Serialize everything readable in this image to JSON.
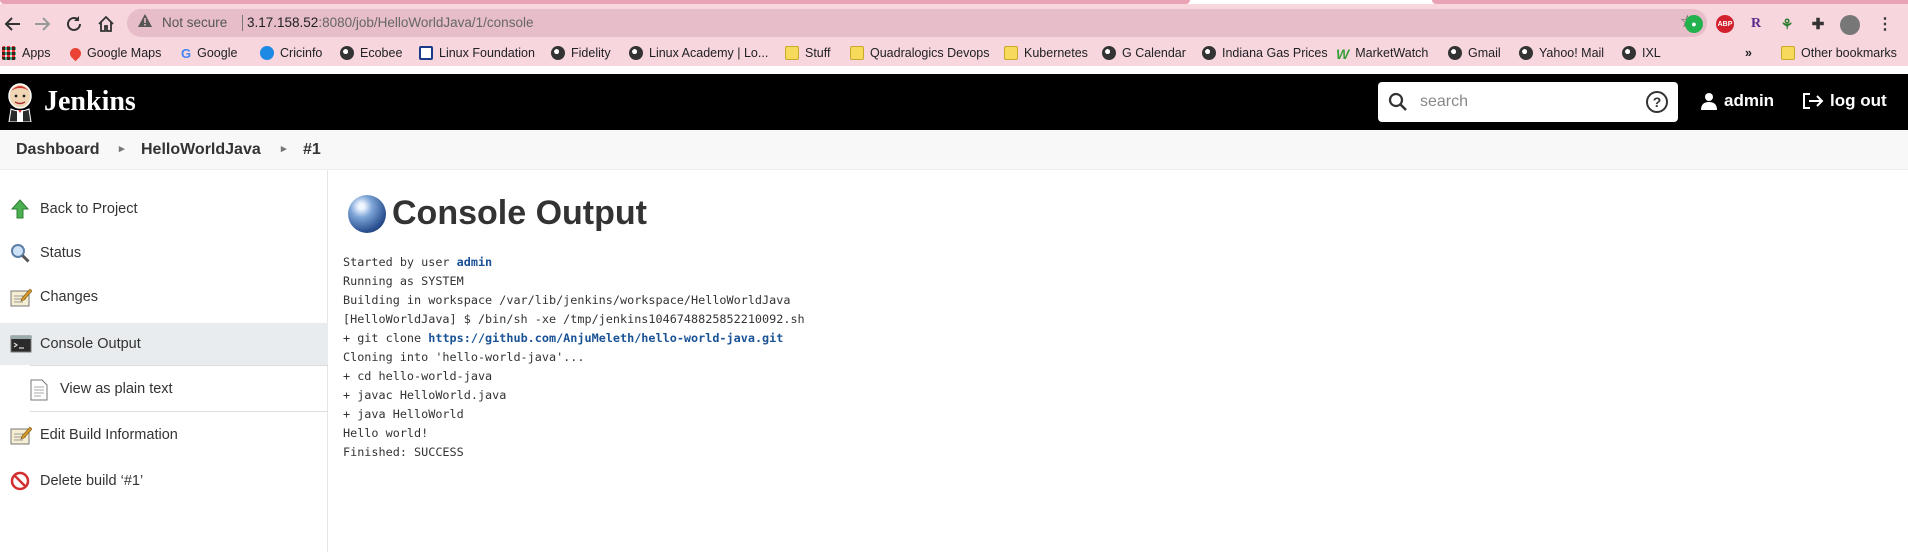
{
  "browser": {
    "security_label": "Not secure",
    "url_host": "3.17.158.52",
    "url_rest": ":8080/job/HelloWorldJava/1/console",
    "bookmarks": [
      {
        "label": "Apps",
        "icon": "apps-grid-icon"
      },
      {
        "label": "Google Maps",
        "icon": "maps-pin-icon"
      },
      {
        "label": "Google",
        "icon": "google-g-icon"
      },
      {
        "label": "Cricinfo",
        "icon": "globe-icon"
      },
      {
        "label": "Ecobee",
        "icon": "globe-icon"
      },
      {
        "label": "Linux Foundation",
        "icon": "square-icon"
      },
      {
        "label": "Fidelity",
        "icon": "globe-icon"
      },
      {
        "label": "Linux Academy | Lo...",
        "icon": "globe-icon"
      },
      {
        "label": "Stuff",
        "icon": "folder-icon"
      },
      {
        "label": "Quadralogics Devops",
        "icon": "folder-icon"
      },
      {
        "label": "Kubernetes",
        "icon": "folder-icon"
      },
      {
        "label": "G Calendar",
        "icon": "globe-icon"
      },
      {
        "label": "Indiana Gas Prices",
        "icon": "globe-icon"
      },
      {
        "label": "MarketWatch",
        "icon": "marketwatch-w-icon"
      },
      {
        "label": "Gmail",
        "icon": "globe-icon"
      },
      {
        "label": "Yahoo! Mail",
        "icon": "globe-icon"
      },
      {
        "label": "IXL",
        "icon": "globe-icon"
      }
    ],
    "more_bookmarks": "»",
    "other_bookmarks": "Other bookmarks",
    "ext_abp": "ABP",
    "ext_r": "R"
  },
  "header": {
    "title": "Jenkins",
    "search_placeholder": "search",
    "help": "?",
    "user": "admin",
    "logout": "log out"
  },
  "breadcrumb": [
    "Dashboard",
    "HelloWorldJava",
    "#1"
  ],
  "sidebar": {
    "items": [
      {
        "label": "Back to Project",
        "icon": "up-arrow-icon"
      },
      {
        "label": "Status",
        "icon": "magnifier-icon"
      },
      {
        "label": "Changes",
        "icon": "notepad-icon"
      },
      {
        "label": "Console Output",
        "icon": "terminal-icon"
      },
      {
        "label": "View as plain text",
        "icon": "document-icon"
      },
      {
        "label": "Edit Build Information",
        "icon": "notepad-edit-icon"
      },
      {
        "label": "Delete build ‘#1’",
        "icon": "no-entry-icon"
      }
    ]
  },
  "main": {
    "title": "Console Output",
    "console": {
      "started_by": "Started by user ",
      "user_link": "admin",
      "lines_a": [
        "Running as SYSTEM",
        "Building in workspace /var/lib/jenkins/workspace/HelloWorldJava",
        "[HelloWorldJava] $ /bin/sh -xe /tmp/jenkins1046748825852210092.sh"
      ],
      "git_clone_prefix": "+ git clone ",
      "repo_link": "https://github.com/AnjuMeleth/hello-world-java.git",
      "lines_b": [
        "Cloning into 'hello-world-java'...",
        "+ cd hello-world-java",
        "+ javac HelloWorld.java",
        "+ java HelloWorld",
        "Hello world!",
        "Finished: SUCCESS"
      ]
    }
  }
}
